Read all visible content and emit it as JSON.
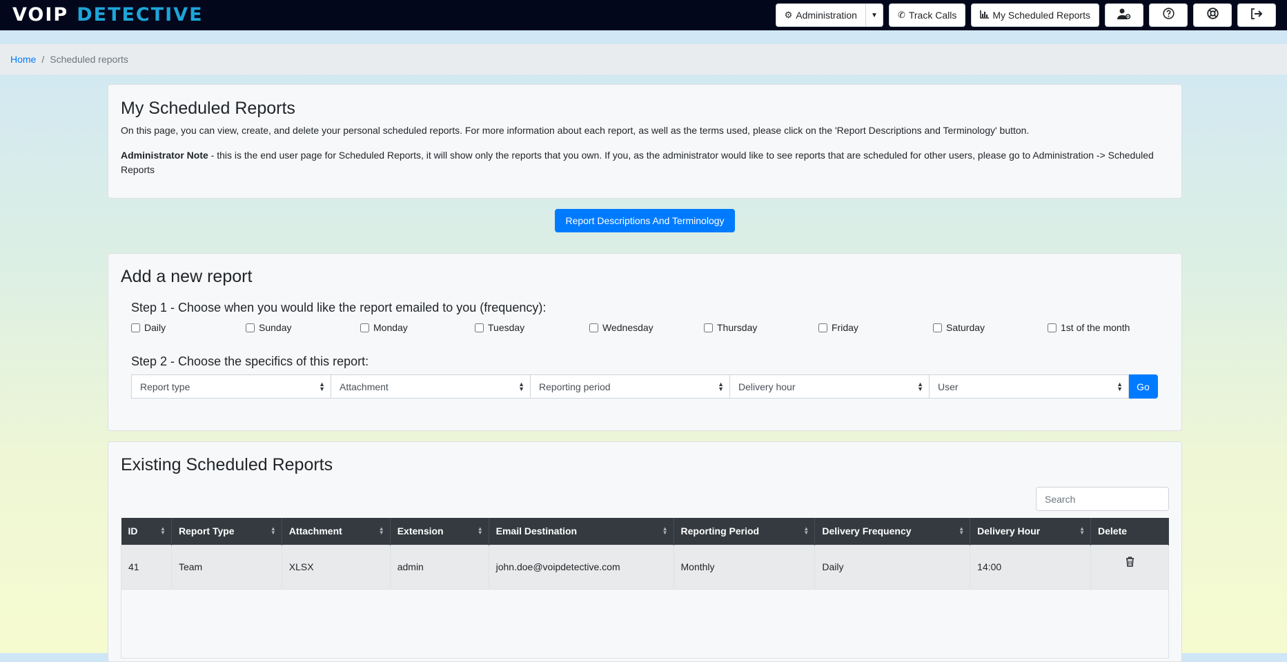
{
  "navbar": {
    "logo_left": "VOIP",
    "logo_right": "DETECTIVE",
    "administration_label": "Administration",
    "track_calls_label": "Track Calls",
    "my_reports_label": "My Scheduled Reports",
    "icons": [
      "user-cog-icon",
      "question-circle-icon",
      "life-ring-icon",
      "sign-out-icon"
    ]
  },
  "breadcrumb": {
    "home": "Home",
    "separator": "/",
    "current": "Scheduled reports"
  },
  "intro": {
    "title": "My Scheduled Reports",
    "description": "On this page, you can view, create, and delete your personal scheduled reports. For more information about each report, as well as the terms used, please click on the 'Report Descriptions and Terminology' button.",
    "note_bold": "Administrator Note",
    "note_text": " - this is the end user page for Scheduled Reports, it will show only the reports that you own. If you, as the administrator would like to see reports that are scheduled for other users, please go to Administration -> Scheduled Reports"
  },
  "terminology_button": "Report Descriptions And Terminology",
  "add_report": {
    "title": "Add a new report",
    "step1": "Step 1 - Choose when you would like the report emailed to you (frequency):",
    "days": [
      "Daily",
      "Sunday",
      "Monday",
      "Tuesday",
      "Wednesday",
      "Thursday",
      "Friday",
      "Saturday",
      "1st of the month"
    ],
    "step2": "Step 2 - Choose the specifics of this report:",
    "selects": [
      "Report type",
      "Attachment",
      "Reporting period",
      "Delivery hour",
      "User"
    ],
    "go_label": "Go"
  },
  "existing": {
    "title": "Existing Scheduled Reports",
    "search_placeholder": "Search",
    "columns": [
      "ID",
      "Report Type",
      "Attachment",
      "Extension",
      "Email Destination",
      "Reporting Period",
      "Delivery Frequency",
      "Delivery Hour",
      "Delete"
    ],
    "rows": [
      [
        "41",
        "Team",
        "XLSX",
        "admin",
        "john.doe@voipdetective.com",
        "Monthly",
        "Daily",
        "14:00"
      ]
    ]
  },
  "colors": {
    "navbar": "#02071c",
    "logo_accent": "#1ea5d8",
    "primary": "#007bff",
    "table_header": "#343a40"
  }
}
